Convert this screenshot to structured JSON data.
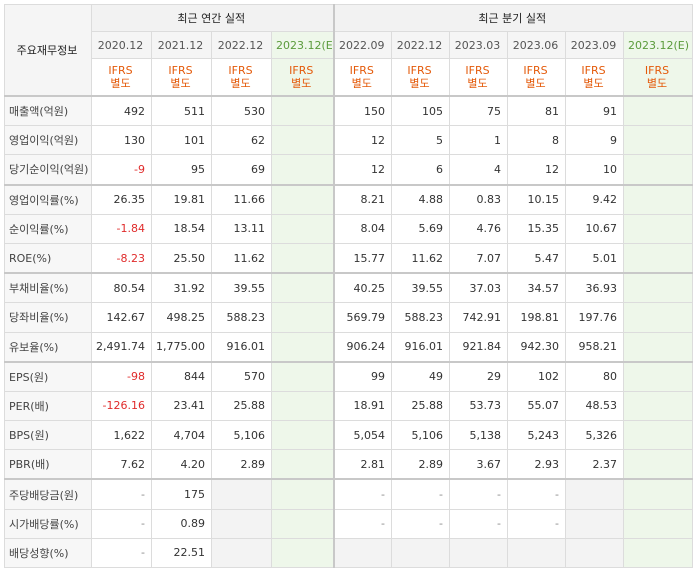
{
  "header": {
    "corner_label": "주요재무정보",
    "annual_title": "최근 연간 실적",
    "quarter_title": "최근 분기 실적",
    "periods": [
      "2020.12",
      "2021.12",
      "2022.12",
      "2023.12(E)",
      "2022.09",
      "2022.12",
      "2023.03",
      "2023.06",
      "2023.09",
      "2023.12(E)"
    ],
    "ifrs_top": "IFRS",
    "ifrs_bottom": "별도"
  },
  "rows": [
    {
      "label": "매출액(억원)",
      "values": [
        "492",
        "511",
        "530",
        "",
        "150",
        "105",
        "75",
        "81",
        "91",
        ""
      ]
    },
    {
      "label": "영업이익(억원)",
      "values": [
        "130",
        "101",
        "62",
        "",
        "12",
        "5",
        "1",
        "8",
        "9",
        ""
      ]
    },
    {
      "label": "당기순이익(억원)",
      "values": [
        "-9",
        "95",
        "69",
        "",
        "12",
        "6",
        "4",
        "12",
        "10",
        ""
      ]
    },
    {
      "label": "영업이익률(%)",
      "values": [
        "26.35",
        "19.81",
        "11.66",
        "",
        "8.21",
        "4.88",
        "0.83",
        "10.15",
        "9.42",
        ""
      ]
    },
    {
      "label": "순이익률(%)",
      "values": [
        "-1.84",
        "18.54",
        "13.11",
        "",
        "8.04",
        "5.69",
        "4.76",
        "15.35",
        "10.67",
        ""
      ]
    },
    {
      "label": "ROE(%)",
      "values": [
        "-8.23",
        "25.50",
        "11.62",
        "",
        "15.77",
        "11.62",
        "7.07",
        "5.47",
        "5.01",
        ""
      ]
    },
    {
      "label": "부채비율(%)",
      "values": [
        "80.54",
        "31.92",
        "39.55",
        "",
        "40.25",
        "39.55",
        "37.03",
        "34.57",
        "36.93",
        ""
      ]
    },
    {
      "label": "당좌비율(%)",
      "values": [
        "142.67",
        "498.25",
        "588.23",
        "",
        "569.79",
        "588.23",
        "742.91",
        "198.81",
        "197.76",
        ""
      ]
    },
    {
      "label": "유보율(%)",
      "values": [
        "2,491.74",
        "1,775.00",
        "916.01",
        "",
        "906.24",
        "916.01",
        "921.84",
        "942.30",
        "958.21",
        ""
      ]
    },
    {
      "label": "EPS(원)",
      "values": [
        "-98",
        "844",
        "570",
        "",
        "99",
        "49",
        "29",
        "102",
        "80",
        ""
      ]
    },
    {
      "label": "PER(배)",
      "values": [
        "-126.16",
        "23.41",
        "25.88",
        "",
        "18.91",
        "25.88",
        "53.73",
        "55.07",
        "48.53",
        ""
      ]
    },
    {
      "label": "BPS(원)",
      "values": [
        "1,622",
        "4,704",
        "5,106",
        "",
        "5,054",
        "5,106",
        "5,138",
        "5,243",
        "5,326",
        ""
      ]
    },
    {
      "label": "PBR(배)",
      "values": [
        "7.62",
        "4.20",
        "2.89",
        "",
        "2.81",
        "2.89",
        "3.67",
        "2.93",
        "2.37",
        ""
      ]
    },
    {
      "label": "주당배당금(원)",
      "values": [
        "-",
        "175",
        "",
        "",
        "-",
        "-",
        "-",
        "-",
        "",
        ""
      ]
    },
    {
      "label": "시가배당률(%)",
      "values": [
        "-",
        "0.89",
        "",
        "",
        "-",
        "-",
        "-",
        "-",
        "",
        ""
      ]
    },
    {
      "label": "배당성향(%)",
      "values": [
        "-",
        "22.51",
        "",
        "",
        "",
        "",
        "",
        "",
        "",
        ""
      ]
    }
  ],
  "colors": {
    "negative": "#e02b2b",
    "ifrs": "#e45a0a",
    "estimate_bg": "#eef7ea",
    "estimate_text": "#5b9b3c"
  }
}
